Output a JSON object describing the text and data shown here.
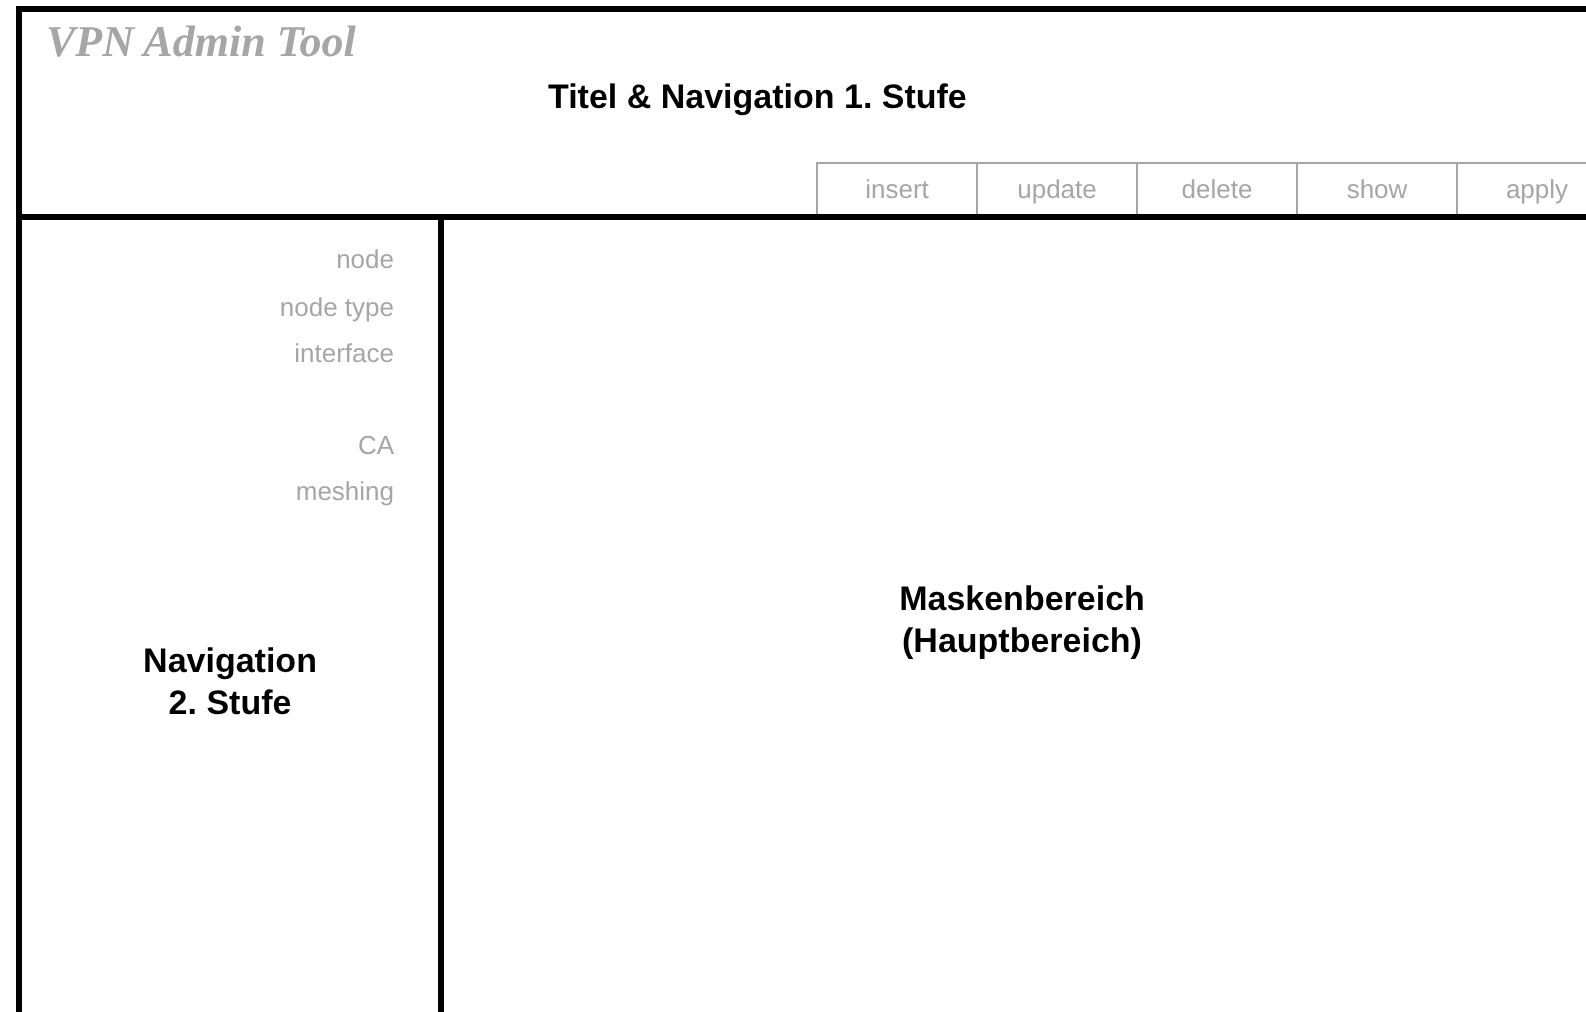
{
  "header": {
    "app_title": "VPN Admin Tool",
    "region_label": "Titel & Navigation 1. Stufe"
  },
  "toolbar": {
    "buttons": [
      "insert",
      "update",
      "delete",
      "show",
      "apply"
    ]
  },
  "sidebar": {
    "groups": [
      {
        "items": [
          "node",
          "node type",
          "interface"
        ]
      },
      {
        "items": [
          "CA",
          "meshing"
        ]
      }
    ],
    "region_label": [
      "Navigation",
      "2. Stufe"
    ]
  },
  "main": {
    "region_label": [
      "Maskenbereich",
      "(Hauptbereich)"
    ]
  }
}
